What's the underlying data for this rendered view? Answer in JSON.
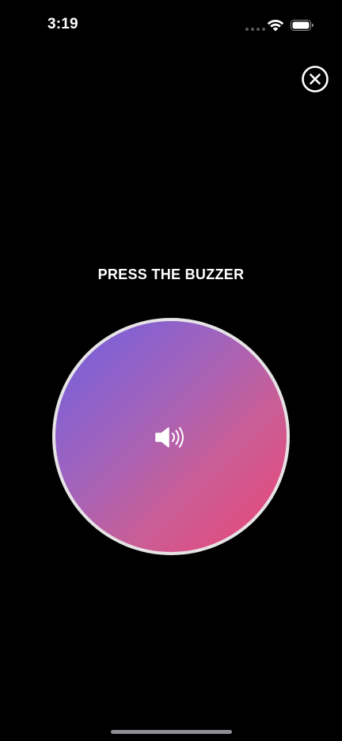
{
  "status_bar": {
    "time": "3:19",
    "icons": [
      "signal-dots-icon",
      "wifi-icon",
      "battery-icon"
    ]
  },
  "header": {
    "close_icon": "close-circle-icon"
  },
  "main": {
    "prompt": "PRESS THE BUZZER",
    "buzzer_icon": "speaker-icon",
    "gradient_colors": [
      "#6f5fe0",
      "#a063bd",
      "#c95e96",
      "#ec4476"
    ],
    "ring_color": "#e6e3e6"
  },
  "colors": {
    "background": "#000000",
    "text": "#ffffff"
  }
}
